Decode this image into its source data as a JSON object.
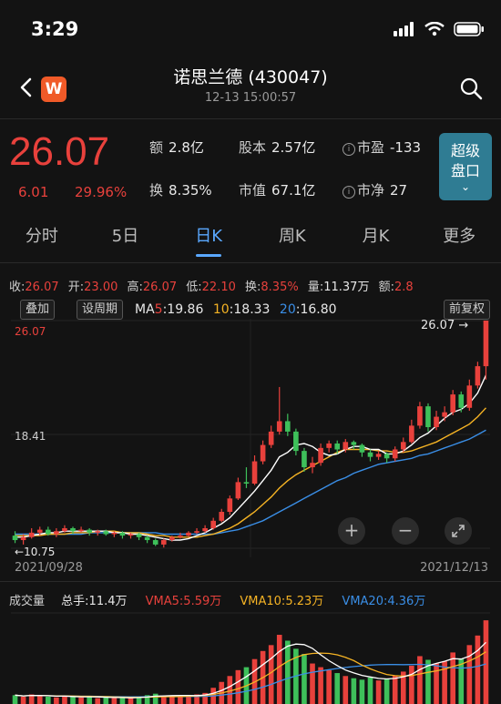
{
  "status": {
    "time": "3:29"
  },
  "header": {
    "logo_letter": "W",
    "title": "诺思兰德 (430047)",
    "subtitle": "12-13 15:00:57"
  },
  "quote": {
    "price": "26.07",
    "change": "6.01",
    "change_pct": "29.96%",
    "stats": {
      "turnover_amount": {
        "label": "额",
        "value": "2.8亿"
      },
      "share_capital": {
        "label": "股本",
        "value": "2.57亿"
      },
      "pe": {
        "label": "市盈",
        "value": "-133"
      },
      "turnover_rate": {
        "label": "换",
        "value": "8.35%"
      },
      "market_cap": {
        "label": "市值",
        "value": "67.1亿"
      },
      "pb": {
        "label": "市净",
        "value": "27"
      }
    },
    "super_button": {
      "line1": "超级",
      "line2": "盘口",
      "chev": "⌄"
    }
  },
  "tabs": [
    {
      "label": "分时",
      "active": false
    },
    {
      "label": "5日",
      "active": false
    },
    {
      "label": "日K",
      "active": true
    },
    {
      "label": "周K",
      "active": false
    },
    {
      "label": "月K",
      "active": false
    },
    {
      "label": "更多",
      "active": false
    }
  ],
  "ohlc": {
    "close_label": "收:",
    "close": "26.07",
    "open_label": "开:",
    "open": "23.00",
    "high_label": "高:",
    "high": "26.07",
    "low_label": "低:",
    "low": "22.10",
    "turn_label": "换:",
    "turn": "8.35%",
    "vol_label": "量:",
    "vol": "11.37万",
    "amt_label": "额:",
    "amt": "2.8"
  },
  "chart_controls": {
    "overlay": "叠加",
    "set_period": "设周期",
    "adjust": "前复权",
    "ma_label": "MA",
    "ma5_key": "5",
    "ma5": ":19.86",
    "ma10_key": "10",
    "ma10": ":18.33",
    "ma20_key": "20",
    "ma20": ":16.80"
  },
  "chart_labels": {
    "max_price": "26.07",
    "latest_callout": "26.07",
    "mid_price": "18.41",
    "min_callout": "10.75",
    "date_start": "2021/09/28",
    "date_end": "2021/12/13"
  },
  "volume": {
    "label": "成交量",
    "total_label": "总手:",
    "total": "11.4万",
    "vma5_label": "VMA5:",
    "vma5": "5.59万",
    "vma10_label": "VMA10:",
    "vma10": "5.23万",
    "vma20_label": "VMA20:",
    "vma20": "4.36万"
  },
  "colors": {
    "up": "#e8413c",
    "down": "#3ec05a",
    "ma5": "#ffffff",
    "ma10": "#f5b324",
    "ma20": "#3a8ee6",
    "accent": "#5aa8ff"
  },
  "chart_data": {
    "type": "candlestick",
    "y_range": [
      10.75,
      26.07
    ],
    "x_range": [
      "2021/09/28",
      "2021/12/13"
    ],
    "candles": [
      [
        11.6,
        11.3,
        11.9,
        11.1
      ],
      [
        11.3,
        11.5,
        11.7,
        11.0
      ],
      [
        11.5,
        11.8,
        12.1,
        11.4
      ],
      [
        11.8,
        12.0,
        12.2,
        11.6
      ],
      [
        12.0,
        11.7,
        12.2,
        11.6
      ],
      [
        11.7,
        11.9,
        12.1,
        11.5
      ],
      [
        11.9,
        12.1,
        12.3,
        11.8
      ],
      [
        12.1,
        11.9,
        12.2,
        11.7
      ],
      [
        11.9,
        12.0,
        12.2,
        11.8
      ],
      [
        12.0,
        11.8,
        12.1,
        11.6
      ],
      [
        11.8,
        11.9,
        12.0,
        11.6
      ],
      [
        11.9,
        11.7,
        12.0,
        11.6
      ],
      [
        11.7,
        11.8,
        11.9,
        11.5
      ],
      [
        11.8,
        11.6,
        11.9,
        11.4
      ],
      [
        11.6,
        11.7,
        11.8,
        11.4
      ],
      [
        11.7,
        11.5,
        11.8,
        11.3
      ],
      [
        11.5,
        11.3,
        11.6,
        11.1
      ],
      [
        11.3,
        11.0,
        11.4,
        10.9
      ],
      [
        11.0,
        11.3,
        11.4,
        10.8
      ],
      [
        11.3,
        11.5,
        11.6,
        11.2
      ],
      [
        11.5,
        11.6,
        11.8,
        11.4
      ],
      [
        11.6,
        11.8,
        11.9,
        11.5
      ],
      [
        11.8,
        11.9,
        12.1,
        11.7
      ],
      [
        11.9,
        12.1,
        12.3,
        11.8
      ],
      [
        12.1,
        12.6,
        12.8,
        12.0
      ],
      [
        12.6,
        13.2,
        13.4,
        12.5
      ],
      [
        13.2,
        14.1,
        14.3,
        13.0
      ],
      [
        14.1,
        15.2,
        15.5,
        14.0
      ],
      [
        15.2,
        15.1,
        16.2,
        14.8
      ],
      [
        15.1,
        16.6,
        17.0,
        15.0
      ],
      [
        16.6,
        17.7,
        18.0,
        16.4
      ],
      [
        17.7,
        18.6,
        19.0,
        17.5
      ],
      [
        18.6,
        19.3,
        21.6,
        18.4
      ],
      [
        19.3,
        18.6,
        19.8,
        18.3
      ],
      [
        18.6,
        17.3,
        18.8,
        17.0
      ],
      [
        17.3,
        16.2,
        17.5,
        15.9
      ],
      [
        16.2,
        16.5,
        16.9,
        15.8
      ],
      [
        16.5,
        17.5,
        17.8,
        16.3
      ],
      [
        17.5,
        17.8,
        18.0,
        17.2
      ],
      [
        17.8,
        17.4,
        18.0,
        17.1
      ],
      [
        17.4,
        17.9,
        18.1,
        17.2
      ],
      [
        17.9,
        17.7,
        18.0,
        17.4
      ],
      [
        17.7,
        17.2,
        17.8,
        16.9
      ],
      [
        17.2,
        16.9,
        17.4,
        16.6
      ],
      [
        16.9,
        17.1,
        17.3,
        16.7
      ],
      [
        17.1,
        16.8,
        17.2,
        16.5
      ],
      [
        16.8,
        17.4,
        17.6,
        16.6
      ],
      [
        17.4,
        17.9,
        18.2,
        17.2
      ],
      [
        17.9,
        19.0,
        19.4,
        17.8
      ],
      [
        19.0,
        20.3,
        20.6,
        18.8
      ],
      [
        20.3,
        18.9,
        20.5,
        18.6
      ],
      [
        18.9,
        19.6,
        20.0,
        18.7
      ],
      [
        19.6,
        19.9,
        20.3,
        19.3
      ],
      [
        19.9,
        21.1,
        21.4,
        19.7
      ],
      [
        21.1,
        20.2,
        21.3,
        19.9
      ],
      [
        20.2,
        21.7,
        22.1,
        20.0
      ],
      [
        21.7,
        23.0,
        23.3,
        21.5
      ],
      [
        23.0,
        26.07,
        26.07,
        22.1
      ]
    ],
    "volumes": [
      1.2,
      1.0,
      1.3,
      1.1,
      1.0,
      0.9,
      1.1,
      1.0,
      0.9,
      1.0,
      0.8,
      0.9,
      0.8,
      0.9,
      0.8,
      1.0,
      1.2,
      1.4,
      1.1,
      1.0,
      1.1,
      1.2,
      1.3,
      1.5,
      2.2,
      3.0,
      3.8,
      4.6,
      5.0,
      6.1,
      7.2,
      8.0,
      9.4,
      8.6,
      7.5,
      6.8,
      5.5,
      5.0,
      4.6,
      4.2,
      3.8,
      3.5,
      3.3,
      3.6,
      3.2,
      3.4,
      3.9,
      4.4,
      5.2,
      6.5,
      6.0,
      5.5,
      5.8,
      7.0,
      6.2,
      8.0,
      9.3,
      11.37
    ],
    "ma5": [
      11.5,
      11.5,
      11.6,
      11.7,
      11.8,
      11.8,
      11.9,
      11.9,
      11.9,
      11.9,
      11.9,
      11.9,
      11.8,
      11.8,
      11.7,
      11.7,
      11.6,
      11.5,
      11.4,
      11.3,
      11.3,
      11.4,
      11.6,
      11.8,
      12.1,
      12.4,
      12.8,
      13.4,
      14.0,
      14.6,
      15.3,
      16.0,
      16.9,
      17.2,
      17.7,
      17.8,
      17.6,
      17.2,
      17.0,
      17.1,
      17.4,
      17.6,
      17.6,
      17.4,
      17.4,
      17.1,
      17.1,
      17.3,
      17.7,
      18.2,
      18.5,
      19.0,
      19.5,
      19.9,
      20.1,
      20.5,
      21.2,
      22.4
    ],
    "ma10": [
      11.6,
      11.6,
      11.6,
      11.6,
      11.7,
      11.7,
      11.7,
      11.8,
      11.8,
      11.8,
      11.9,
      11.9,
      11.9,
      11.8,
      11.8,
      11.8,
      11.7,
      11.6,
      11.6,
      11.5,
      11.5,
      11.5,
      11.5,
      11.6,
      11.7,
      11.9,
      12.1,
      12.4,
      12.8,
      13.2,
      13.7,
      14.2,
      14.8,
      15.3,
      15.7,
      16.0,
      16.3,
      16.6,
      16.9,
      17.2,
      17.4,
      17.4,
      17.4,
      17.4,
      17.3,
      17.3,
      17.2,
      17.2,
      17.3,
      17.5,
      17.7,
      17.9,
      18.2,
      18.5,
      18.8,
      19.1,
      19.6,
      20.2
    ],
    "ma20": [
      11.7,
      11.7,
      11.7,
      11.7,
      11.7,
      11.7,
      11.7,
      11.7,
      11.7,
      11.8,
      11.8,
      11.8,
      11.8,
      11.8,
      11.8,
      11.8,
      11.8,
      11.8,
      11.7,
      11.7,
      11.7,
      11.7,
      11.7,
      11.7,
      11.7,
      11.8,
      11.9,
      12.0,
      12.2,
      12.4,
      12.6,
      12.9,
      13.2,
      13.5,
      13.8,
      14.1,
      14.4,
      14.7,
      15.0,
      15.3,
      15.5,
      15.8,
      16.0,
      16.2,
      16.4,
      16.5,
      16.6,
      16.7,
      16.8,
      17.0,
      17.1,
      17.3,
      17.5,
      17.7,
      17.9,
      18.1,
      18.4,
      18.7
    ]
  }
}
